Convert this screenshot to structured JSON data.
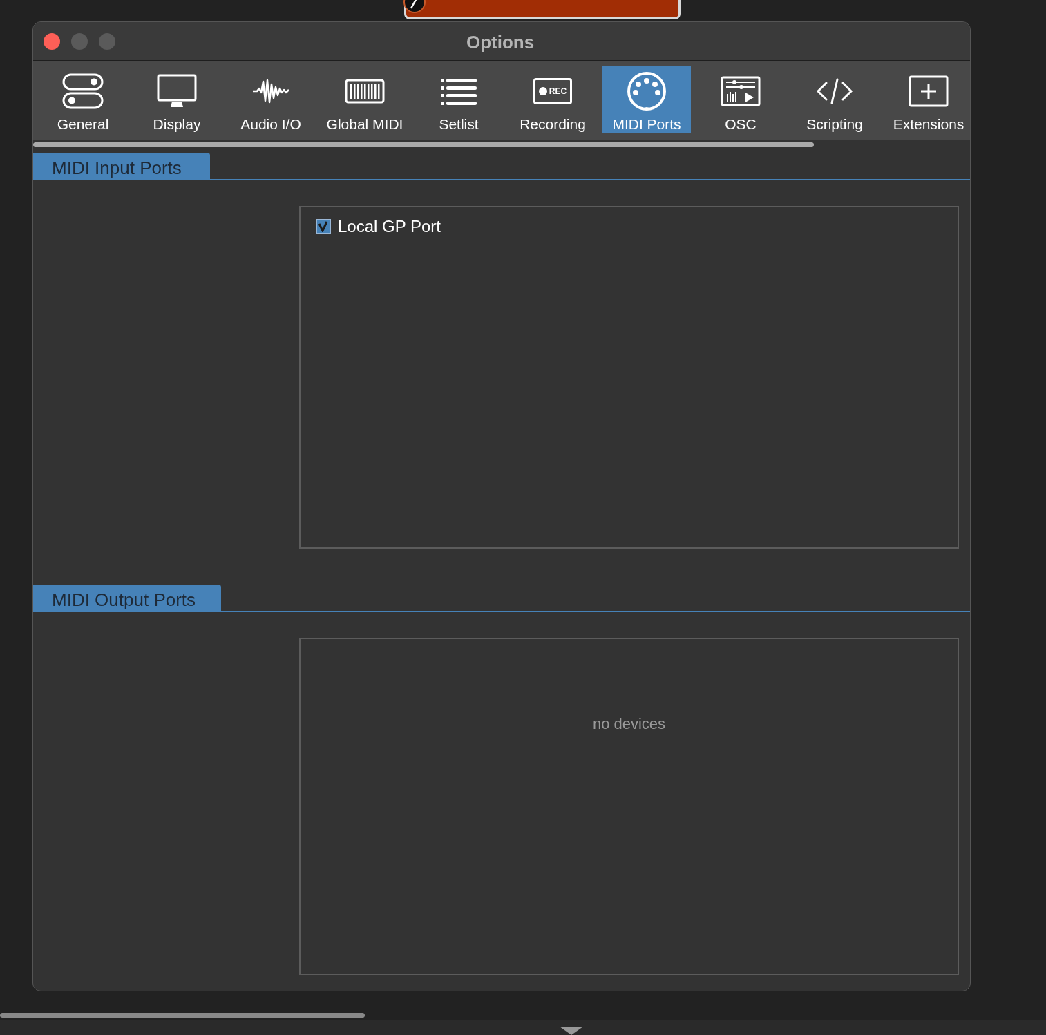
{
  "window": {
    "title": "Options"
  },
  "tabs": [
    {
      "label": "General",
      "kind": "toggles",
      "selected": false
    },
    {
      "label": "Display",
      "kind": "monitor",
      "selected": false
    },
    {
      "label": "Audio I/O",
      "kind": "wave",
      "selected": false
    },
    {
      "label": "Global MIDI",
      "kind": "keyboard",
      "selected": false
    },
    {
      "label": "Setlist",
      "kind": "list",
      "selected": false
    },
    {
      "label": "Recording",
      "kind": "rec",
      "icon_text": "REC",
      "selected": false
    },
    {
      "label": "MIDI Ports",
      "kind": "din",
      "selected": true
    },
    {
      "label": "OSC",
      "kind": "osc",
      "selected": false
    },
    {
      "label": "Scripting",
      "kind": "code",
      "selected": false
    },
    {
      "label": "Extensions",
      "kind": "plus",
      "selected": false
    }
  ],
  "sections": [
    {
      "title": "MIDI Input Ports",
      "ports": [
        {
          "label": "Local GP Port",
          "checked": true
        }
      ]
    },
    {
      "title": "MIDI Output Ports",
      "empty_text": "no devices"
    }
  ]
}
